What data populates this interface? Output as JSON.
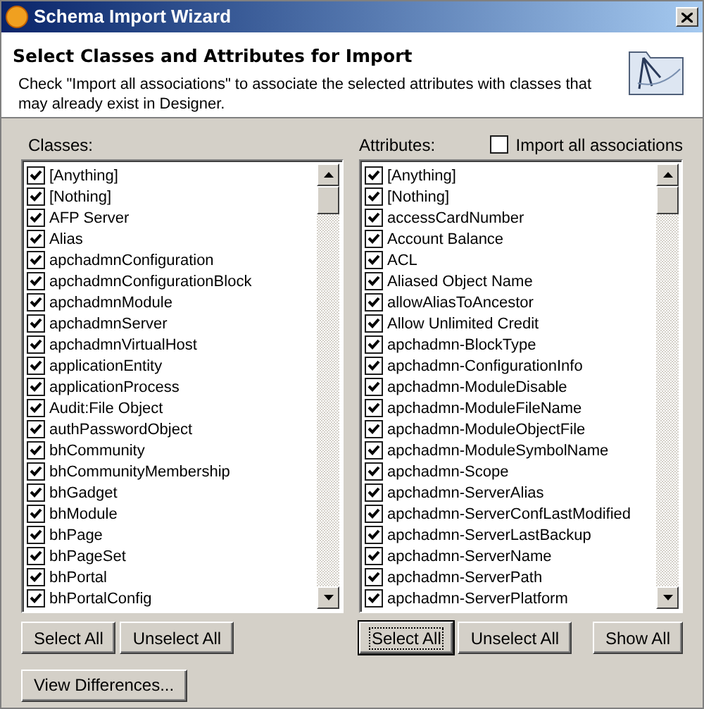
{
  "window": {
    "title": "Schema Import Wizard"
  },
  "header": {
    "title": "Select Classes and Attributes for Import",
    "description": "Check \"Import all associations\" to associate the selected attributes with classes that may already exist in Designer."
  },
  "classes": {
    "label": "Classes:",
    "items": [
      {
        "label": "[Anything]",
        "checked": true
      },
      {
        "label": "[Nothing]",
        "checked": true
      },
      {
        "label": "AFP Server",
        "checked": true
      },
      {
        "label": "Alias",
        "checked": true
      },
      {
        "label": "apchadmnConfiguration",
        "checked": true
      },
      {
        "label": "apchadmnConfigurationBlock",
        "checked": true
      },
      {
        "label": "apchadmnModule",
        "checked": true
      },
      {
        "label": "apchadmnServer",
        "checked": true
      },
      {
        "label": "apchadmnVirtualHost",
        "checked": true
      },
      {
        "label": "applicationEntity",
        "checked": true
      },
      {
        "label": "applicationProcess",
        "checked": true
      },
      {
        "label": "Audit:File Object",
        "checked": true
      },
      {
        "label": "authPasswordObject",
        "checked": true
      },
      {
        "label": "bhCommunity",
        "checked": true
      },
      {
        "label": "bhCommunityMembership",
        "checked": true
      },
      {
        "label": "bhGadget",
        "checked": true
      },
      {
        "label": "bhModule",
        "checked": true
      },
      {
        "label": "bhPage",
        "checked": true
      },
      {
        "label": "bhPageSet",
        "checked": true
      },
      {
        "label": "bhPortal",
        "checked": true
      },
      {
        "label": "bhPortalConfig",
        "checked": true
      }
    ],
    "buttons": [
      {
        "label": "Select All",
        "focused": false
      },
      {
        "label": "Unselect All",
        "focused": false
      }
    ]
  },
  "attributes": {
    "label": "Attributes:",
    "import_all": {
      "label": "Import all associations",
      "checked": false
    },
    "items": [
      {
        "label": "[Anything]",
        "checked": true
      },
      {
        "label": "[Nothing]",
        "checked": true
      },
      {
        "label": "accessCardNumber",
        "checked": true
      },
      {
        "label": "Account Balance",
        "checked": true
      },
      {
        "label": "ACL",
        "checked": true
      },
      {
        "label": "Aliased Object Name",
        "checked": true
      },
      {
        "label": "allowAliasToAncestor",
        "checked": true
      },
      {
        "label": "Allow Unlimited Credit",
        "checked": true
      },
      {
        "label": "apchadmn-BlockType",
        "checked": true
      },
      {
        "label": "apchadmn-ConfigurationInfo",
        "checked": true
      },
      {
        "label": "apchadmn-ModuleDisable",
        "checked": true
      },
      {
        "label": "apchadmn-ModuleFileName",
        "checked": true
      },
      {
        "label": "apchadmn-ModuleObjectFile",
        "checked": true
      },
      {
        "label": "apchadmn-ModuleSymbolName",
        "checked": true
      },
      {
        "label": "apchadmn-Scope",
        "checked": true
      },
      {
        "label": "apchadmn-ServerAlias",
        "checked": true
      },
      {
        "label": "apchadmn-ServerConfLastModified",
        "checked": true
      },
      {
        "label": "apchadmn-ServerLastBackup",
        "checked": true
      },
      {
        "label": "apchadmn-ServerName",
        "checked": true
      },
      {
        "label": "apchadmn-ServerPath",
        "checked": true
      },
      {
        "label": "apchadmn-ServerPlatform",
        "checked": true
      }
    ],
    "buttons": [
      {
        "label": "Select All",
        "focused": true
      },
      {
        "label": "Unselect All",
        "focused": false
      }
    ],
    "show_all": {
      "label": "Show All"
    }
  },
  "footer": {
    "button": "View Differences..."
  }
}
